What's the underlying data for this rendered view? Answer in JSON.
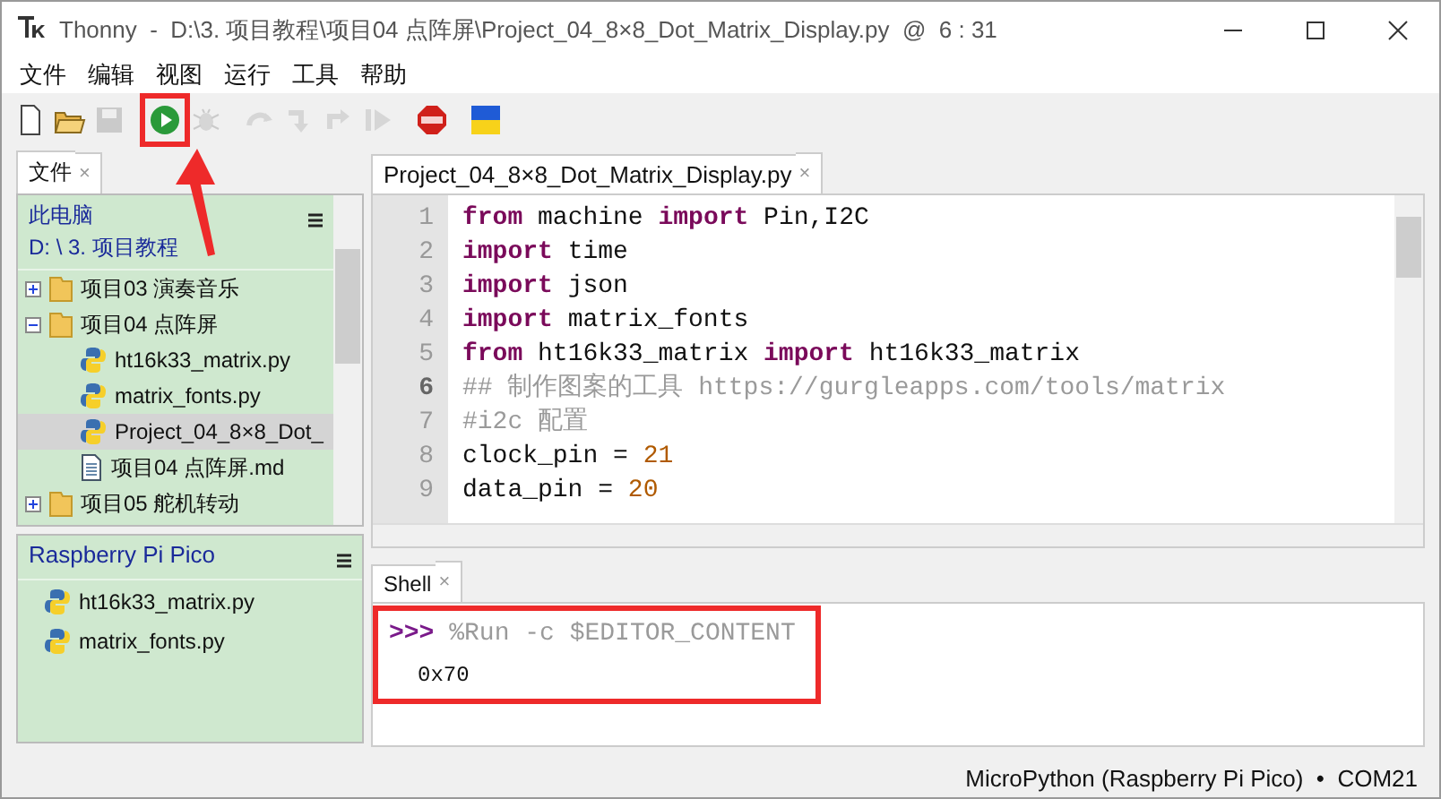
{
  "window": {
    "title": "Thonny  -  D:\\3. 项目教程\\项目04 点阵屏\\Project_04_8×8_Dot_Matrix_Display.py  @  6 : 31"
  },
  "menu": [
    "文件",
    "编辑",
    "视图",
    "运行",
    "工具",
    "帮助"
  ],
  "toolbar": [
    {
      "kind": "new",
      "enabled": true,
      "highlighted": false
    },
    {
      "kind": "open",
      "enabled": true,
      "highlighted": false
    },
    {
      "kind": "save",
      "enabled": false,
      "highlighted": false
    },
    {
      "kind": "run",
      "enabled": true,
      "highlighted": true
    },
    {
      "kind": "debug",
      "enabled": false,
      "highlighted": false
    },
    {
      "kind": "step-over",
      "enabled": false,
      "highlighted": false
    },
    {
      "kind": "step-into",
      "enabled": false,
      "highlighted": false
    },
    {
      "kind": "step-out",
      "enabled": false,
      "highlighted": false
    },
    {
      "kind": "resume",
      "enabled": false,
      "highlighted": false
    },
    {
      "kind": "stop",
      "enabled": true,
      "highlighted": false
    },
    {
      "kind": "flag",
      "enabled": true,
      "highlighted": false
    }
  ],
  "files_panel": {
    "tab": {
      "label": "文件",
      "close": "×"
    },
    "location": "此电脑",
    "path": "D: \\ 3. 项目教程",
    "tree": [
      {
        "name": "项目03 演奏音乐",
        "kind": "folder",
        "expanded": false,
        "selected": false
      },
      {
        "name": "项目04 点阵屏",
        "kind": "folder",
        "expanded": true,
        "selected": false,
        "children": [
          {
            "name": "ht16k33_matrix.py",
            "kind": "python",
            "selected": false
          },
          {
            "name": "matrix_fonts.py",
            "kind": "python",
            "selected": false
          },
          {
            "name": "Project_04_8×8_Dot_",
            "kind": "python",
            "selected": true
          },
          {
            "name": "项目04 点阵屏.md",
            "kind": "text",
            "selected": false
          }
        ]
      },
      {
        "name": "项目05 舵机转动",
        "kind": "folder",
        "expanded": false,
        "selected": false
      }
    ]
  },
  "device_panel": {
    "title": "Raspberry Pi Pico",
    "files": [
      {
        "name": "ht16k33_matrix.py",
        "kind": "python"
      },
      {
        "name": "matrix_fonts.py",
        "kind": "python"
      }
    ]
  },
  "editor": {
    "tab": {
      "label": "Project_04_8×8_Dot_Matrix_Display.py",
      "close": "×"
    },
    "lines": [
      {
        "number": "1",
        "current": false,
        "tokens": [
          {
            "text": "from",
            "kind": "keyword"
          },
          {
            "text": " machine ",
            "kind": "plain"
          },
          {
            "text": "import",
            "kind": "keyword"
          },
          {
            "text": " Pin,I2C",
            "kind": "plain"
          }
        ]
      },
      {
        "number": "2",
        "current": false,
        "tokens": [
          {
            "text": "import",
            "kind": "keyword"
          },
          {
            "text": " time",
            "kind": "plain"
          }
        ]
      },
      {
        "number": "3",
        "current": false,
        "tokens": [
          {
            "text": "import",
            "kind": "keyword"
          },
          {
            "text": " json",
            "kind": "plain"
          }
        ]
      },
      {
        "number": "4",
        "current": false,
        "tokens": [
          {
            "text": "import",
            "kind": "keyword"
          },
          {
            "text": " matrix_fonts",
            "kind": "plain"
          }
        ]
      },
      {
        "number": "5",
        "current": false,
        "tokens": [
          {
            "text": "from",
            "kind": "keyword"
          },
          {
            "text": " ht16k33_matrix ",
            "kind": "plain"
          },
          {
            "text": "import",
            "kind": "keyword"
          },
          {
            "text": " ht16k33_matrix",
            "kind": "plain"
          }
        ]
      },
      {
        "number": "6",
        "current": true,
        "tokens": [
          {
            "text": "## 制作图案的工具 https://gurgleapps.com/tools/matrix",
            "kind": "comment"
          }
        ]
      },
      {
        "number": "7",
        "current": false,
        "tokens": [
          {
            "text": "#i2c 配置",
            "kind": "comment"
          }
        ]
      },
      {
        "number": "8",
        "current": false,
        "tokens": [
          {
            "text": "clock_pin = ",
            "kind": "plain"
          },
          {
            "text": "21",
            "kind": "number"
          }
        ]
      },
      {
        "number": "9",
        "current": false,
        "tokens": [
          {
            "text": "data_pin = ",
            "kind": "plain"
          },
          {
            "text": "20",
            "kind": "number"
          }
        ]
      }
    ]
  },
  "shell": {
    "tab": {
      "label": "Shell",
      "close": "×"
    },
    "highlighted": true,
    "prompt": ">>>",
    "command": "%Run -c $EDITOR_CONTENT",
    "output": "0x70"
  },
  "status_bar": "MicroPython (Raspberry Pi Pico)  •  COM21"
}
